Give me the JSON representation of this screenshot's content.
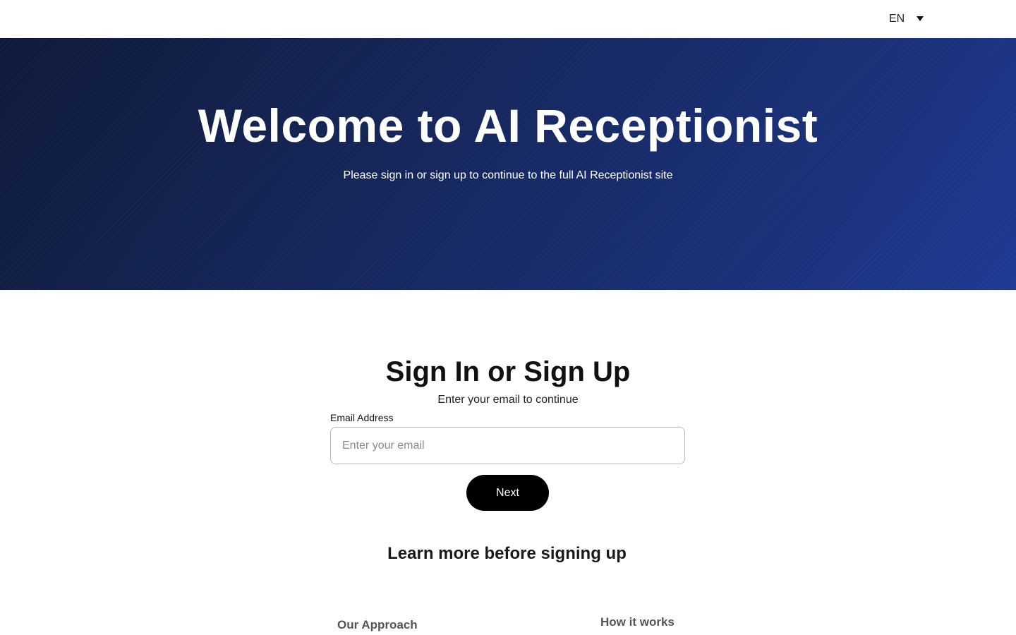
{
  "header": {
    "language": {
      "selected": "EN",
      "icon": "caret-down-icon"
    }
  },
  "hero": {
    "title": "Welcome to AI Receptionist",
    "subtitle": "Please sign in or sign up to continue to the full AI Receptionist site",
    "gradient_colors": [
      "#0e1a3a",
      "#1e3a92"
    ]
  },
  "auth": {
    "heading": "Sign In or Sign Up",
    "subheading": "Enter your email to continue",
    "email_label": "Email Address",
    "email_value": "",
    "email_placeholder": "Enter your email",
    "next_label": "Next",
    "button_color": "#000000"
  },
  "learn_more": {
    "heading": "Learn more before signing up",
    "links": [
      {
        "label": "Our Approach"
      },
      {
        "label": "How it works"
      }
    ]
  }
}
